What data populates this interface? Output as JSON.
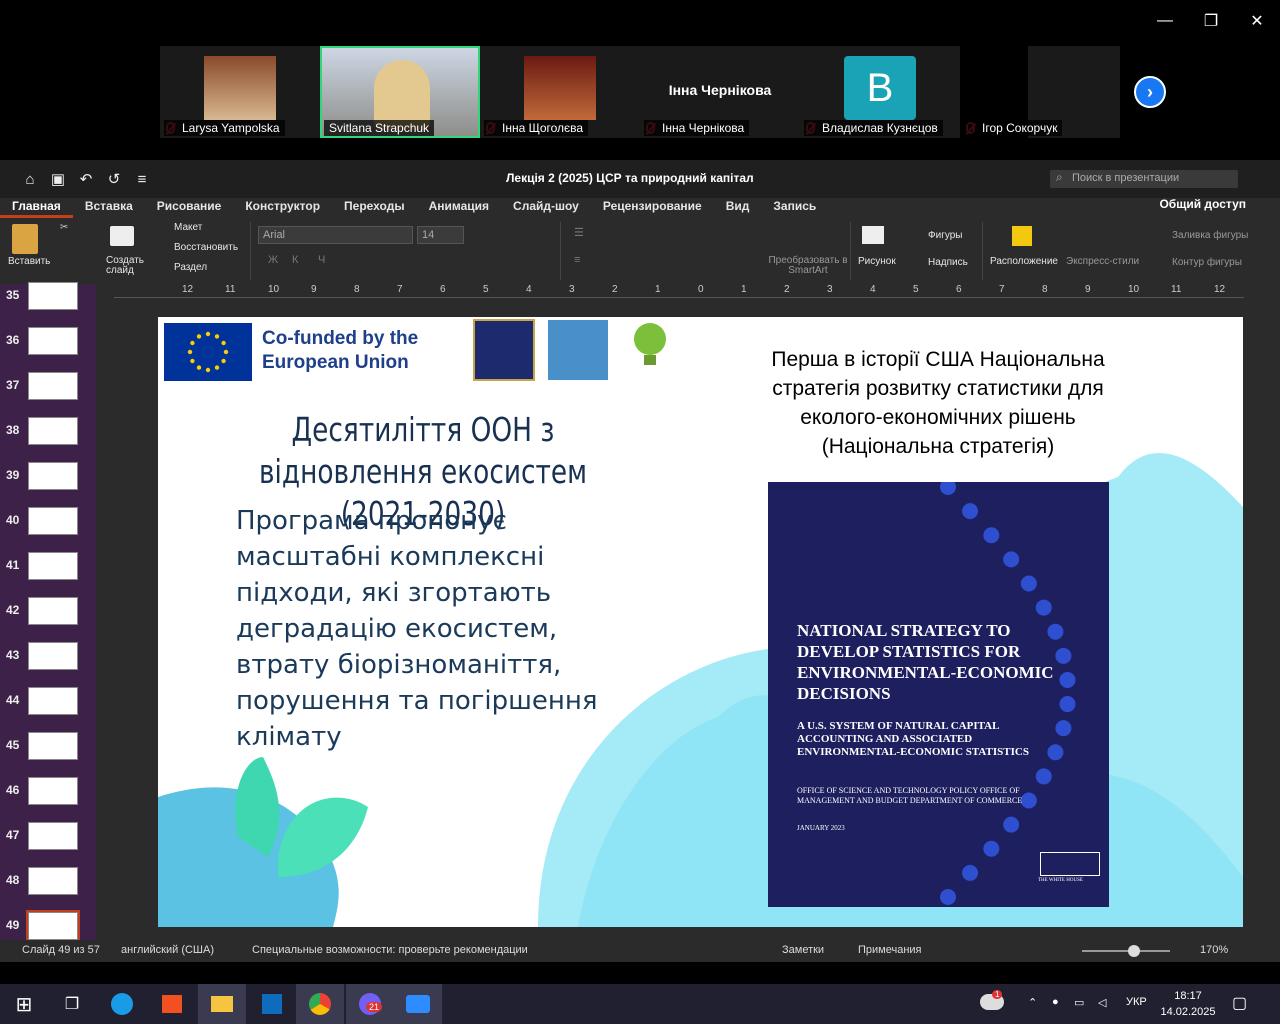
{
  "zoom_window": {
    "minimize": "—",
    "restore": "❐",
    "close": "✕"
  },
  "participants": [
    {
      "name": "Larysa Yampolska",
      "muted": true
    },
    {
      "name": "Svitlana Strapchuk",
      "muted": false,
      "active": true
    },
    {
      "name": "Інна Щоголєва",
      "muted": true
    },
    {
      "name": "Інна Чернікова",
      "muted": true,
      "display_name": "Інна Чернікова"
    },
    {
      "name": "Владислав Кузнєцов",
      "muted": true,
      "avatar_letter": "В"
    },
    {
      "name": "Ігор Сокорчук",
      "muted": true
    }
  ],
  "doc_title": "Лекція 2 (2025) ЦСР та природний капітал",
  "search_placeholder": "Поиск в презентации",
  "tabs": [
    "Главная",
    "Вставка",
    "Рисование",
    "Конструктор",
    "Переходы",
    "Анимация",
    "Слайд-шоу",
    "Рецензирование",
    "Вид",
    "Запись"
  ],
  "share_label": "Общий доступ",
  "ribbon": {
    "paste": "Вставить",
    "new_slide": "Создать слайд",
    "layout": "Макет",
    "reset": "Восстановить",
    "section": "Раздел",
    "font": "Arial",
    "size": "14",
    "smartart": "Преобразовать в SmartArt",
    "picture": "Рисунок",
    "shapes": "Фигуры",
    "textbox": "Надпись",
    "arrange": "Расположение",
    "quick_styles": "Экспресс-стили",
    "shape_fill": "Заливка фигуры",
    "shape_outline": "Контур фигуры"
  },
  "ruler": [
    "12",
    "11",
    "10",
    "9",
    "8",
    "7",
    "6",
    "5",
    "4",
    "3",
    "2",
    "1",
    "0",
    "1",
    "2",
    "3",
    "4",
    "5",
    "6",
    "7",
    "8",
    "9",
    "10",
    "11",
    "12"
  ],
  "thumbs": [
    "35",
    "36",
    "37",
    "38",
    "39",
    "40",
    "41",
    "42",
    "43",
    "44",
    "45",
    "46",
    "47",
    "48",
    "49"
  ],
  "slide": {
    "cofund": "Co-funded by the European Union",
    "heading": "Десятиліття ООН з відновлення екосистем (2021-2030)",
    "body": "Програма пропонує масштабні комплексні підходи, які згортають деградацію екосистем, втрату біорізноманіття, порушення та погіршення клімату",
    "right_title": "Перша в історії США Національна стратегія розвитку статистики для еколого-економічних рішень (Національна стратегія)",
    "book_title": "NATIONAL STRATEGY TO DEVELOP STATISTICS FOR ENVIRONMENTAL-ECONOMIC DECISIONS",
    "book_sub": "A U.S. SYSTEM OF NATURAL CAPITAL ACCOUNTING AND ASSOCIATED ENVIRONMENTAL-ECONOMIC STATISTICS",
    "book_offices": "OFFICE OF SCIENCE AND TECHNOLOGY POLICY OFFICE OF MANAGEMENT AND BUDGET DEPARTMENT OF COMMERCE",
    "book_date": "JANUARY 2023",
    "book_wh": "THE WHITE HOUSE"
  },
  "status": {
    "slide": "Слайд 49 из 57",
    "lang": "английский (США)",
    "access": "Специальные возможности: проверьте рекомендации",
    "notes": "Заметки",
    "comments": "Примечания",
    "zoom": "170%"
  },
  "taskbar": {
    "chat_badge": "21",
    "lang": "УКР",
    "time": "18:17",
    "date": "14.02.2025",
    "weather_badge": "1"
  },
  "colors": {
    "accent": "#c43e1c",
    "active_outline": "#2fd67a",
    "zoom_blue": "#1877f2",
    "book": "#1e1f5e",
    "cloud": "#8fe4f5"
  }
}
